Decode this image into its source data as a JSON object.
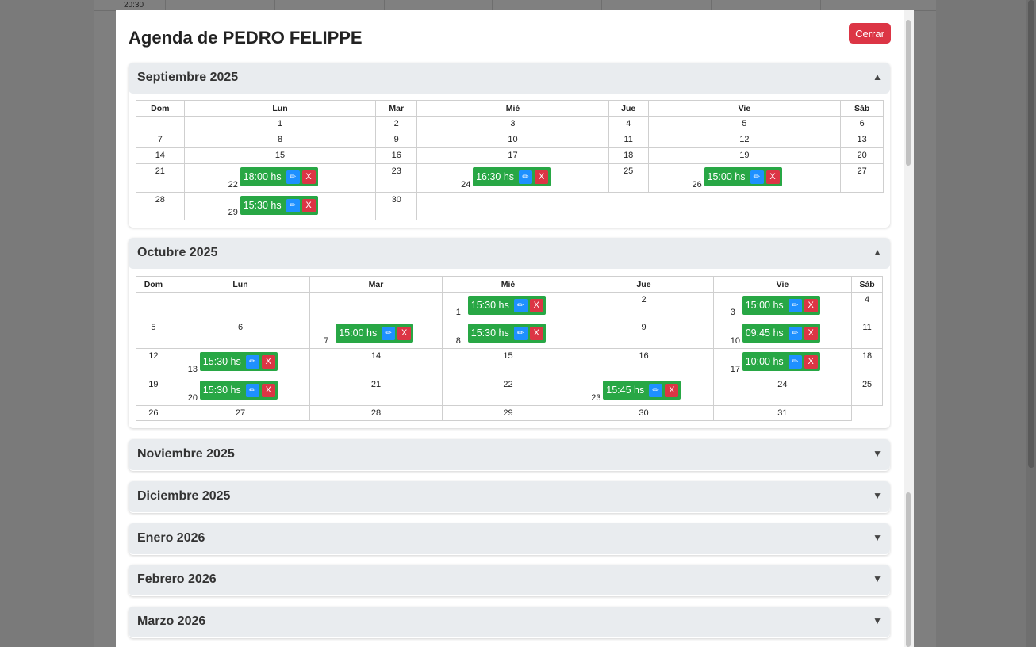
{
  "background": {
    "time_label": "20:30"
  },
  "modal": {
    "title": "Agenda de PEDRO FELIPPE",
    "close_label": "Cerrar",
    "expanded_arrow": "▲",
    "collapsed_arrow": "▼",
    "weekdays": [
      "Dom",
      "Lun",
      "Mar",
      "Mié",
      "Jue",
      "Vie",
      "Sáb"
    ],
    "edit_icon": "✏",
    "delete_label": "X"
  },
  "months": [
    {
      "title": "Septiembre 2025",
      "expanded": true,
      "weeks": [
        [
          "",
          "1",
          "2",
          "3",
          "4",
          "5",
          "6"
        ],
        [
          "7",
          "8",
          "9",
          "10",
          "11",
          "12",
          "13"
        ],
        [
          "14",
          "15",
          "16",
          "17",
          "18",
          "19",
          "20"
        ],
        [
          "21",
          "22",
          "23",
          "24",
          "25",
          "26",
          "27"
        ],
        [
          "28",
          "29",
          "30"
        ]
      ],
      "appointments": [
        {
          "day": "22",
          "time": "18:00 hs"
        },
        {
          "day": "24",
          "time": "16:30 hs"
        },
        {
          "day": "26",
          "time": "15:00 hs"
        },
        {
          "day": "29",
          "time": "15:30 hs"
        }
      ]
    },
    {
      "title": "Octubre 2025",
      "expanded": true,
      "weeks": [
        [
          "",
          "",
          "",
          "1",
          "2",
          "3",
          "4"
        ],
        [
          "5",
          "6",
          "7",
          "8",
          "9",
          "10",
          "11"
        ],
        [
          "12",
          "13",
          "14",
          "15",
          "16",
          "17",
          "18"
        ],
        [
          "19",
          "20",
          "21",
          "22",
          "23",
          "24",
          "25"
        ],
        [
          "26",
          "27",
          "28",
          "29",
          "30",
          "31"
        ]
      ],
      "appointments": [
        {
          "day": "1",
          "time": "15:30 hs"
        },
        {
          "day": "3",
          "time": "15:00 hs"
        },
        {
          "day": "7",
          "time": "15:00 hs"
        },
        {
          "day": "8",
          "time": "15:30 hs"
        },
        {
          "day": "10",
          "time": "09:45 hs"
        },
        {
          "day": "13",
          "time": "15:30 hs"
        },
        {
          "day": "17",
          "time": "10:00 hs"
        },
        {
          "day": "20",
          "time": "15:30 hs"
        },
        {
          "day": "23",
          "time": "15:45 hs"
        }
      ]
    },
    {
      "title": "Noviembre 2025",
      "expanded": false
    },
    {
      "title": "Diciembre 2025",
      "expanded": false
    },
    {
      "title": "Enero 2026",
      "expanded": false
    },
    {
      "title": "Febrero 2026",
      "expanded": false
    },
    {
      "title": "Marzo 2026",
      "expanded": false
    }
  ]
}
